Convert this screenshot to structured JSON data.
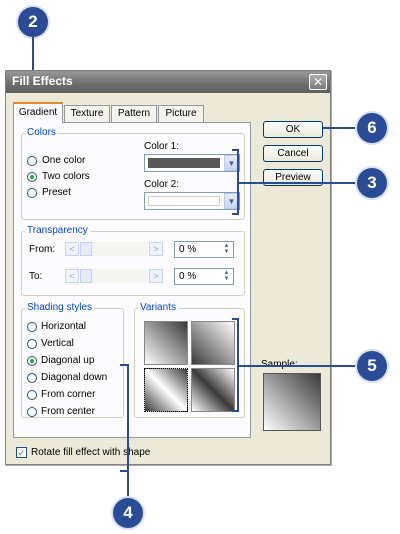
{
  "dialog": {
    "title": "Fill Effects",
    "tabs": [
      {
        "label": "Gradient",
        "active": true
      },
      {
        "label": "Texture",
        "active": false
      },
      {
        "label": "Pattern",
        "active": false
      },
      {
        "label": "Picture",
        "active": false
      }
    ],
    "colors": {
      "group_label": "Colors",
      "options": [
        {
          "label": "One color",
          "selected": false
        },
        {
          "label": "Two colors",
          "selected": true
        },
        {
          "label": "Preset",
          "selected": false
        }
      ],
      "color1_label": "Color 1:",
      "color1_value": "#595959",
      "color2_label": "Color 2:",
      "color2_value": "#ffffff"
    },
    "transparency": {
      "group_label": "Transparency",
      "from_label": "From:",
      "from_value": "0 %",
      "to_label": "To:",
      "to_value": "0 %"
    },
    "shading": {
      "group_label": "Shading styles",
      "options": [
        {
          "label": "Horizontal",
          "selected": false
        },
        {
          "label": "Vertical",
          "selected": false
        },
        {
          "label": "Diagonal up",
          "selected": true
        },
        {
          "label": "Diagonal down",
          "selected": false
        },
        {
          "label": "From corner",
          "selected": false
        },
        {
          "label": "From center",
          "selected": false
        }
      ]
    },
    "variants_label": "Variants",
    "sample_label": "Sample:",
    "checkbox": {
      "label": "Rotate fill effect with shape",
      "checked": true
    },
    "buttons": {
      "ok": "OK",
      "cancel": "Cancel",
      "preview": "Preview"
    }
  },
  "callouts": [
    "2",
    "6",
    "3",
    "5",
    "4"
  ],
  "accent_color": "#2a4c96"
}
